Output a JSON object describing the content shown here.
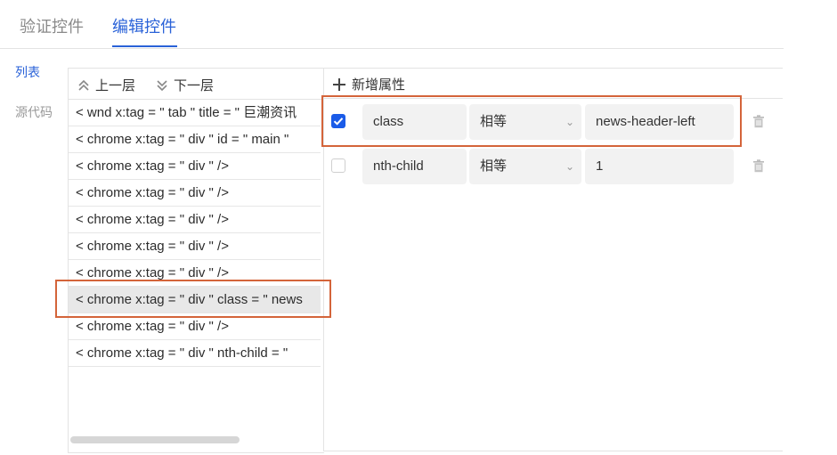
{
  "tabs": {
    "verify": "验证控件",
    "edit": "编辑控件"
  },
  "sidebar": {
    "list": "列表",
    "source": "源代码"
  },
  "toolbar": {
    "up": "上一层",
    "down": "下一层"
  },
  "tree": {
    "rows": [
      "< wnd  x:tag = \" tab \"  title = \" 巨潮资讯",
      "< chrome  x:tag = \" div \"  id = \" main \"",
      "< chrome  x:tag = \" div \" />",
      "< chrome  x:tag = \" div \" />",
      "< chrome  x:tag = \" div \" />",
      "< chrome  x:tag = \" div \" />",
      "< chrome  x:tag = \" div \" />",
      "< chrome  x:tag = \" div \"  class = \" news",
      "< chrome  x:tag = \" div \" />",
      "< chrome  x:tag = \" div \"  nth-child = \""
    ],
    "selected_index": 7
  },
  "attrs": {
    "add_label": "新增属性",
    "rows": [
      {
        "checked": true,
        "name": "class",
        "op": "相等",
        "value": "news-header-left"
      },
      {
        "checked": false,
        "name": "nth-child",
        "op": "相等",
        "value": "1"
      }
    ]
  },
  "colors": {
    "accent": "#2a62d8",
    "highlight": "#d4643a",
    "checkbox": "#1a5be8"
  }
}
